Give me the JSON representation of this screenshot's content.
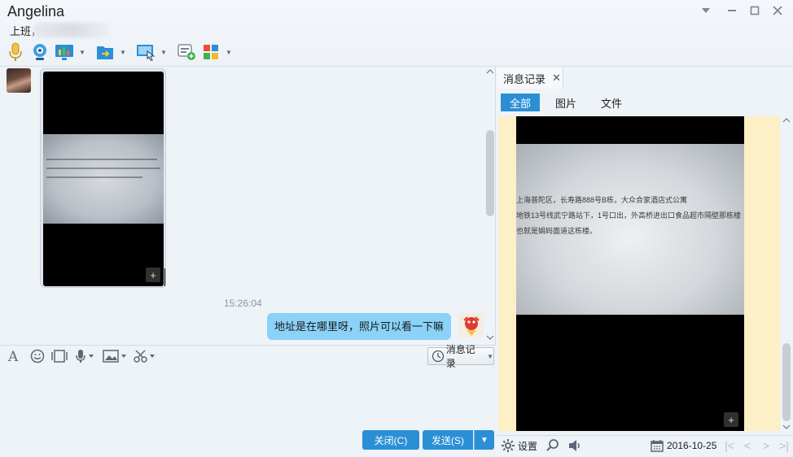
{
  "window": {
    "contact_name": "Angelina",
    "status": "上班，"
  },
  "chat": {
    "timestamp": "15:26:04",
    "outgoing_message": "地址是在哪里呀，照片可以看一下嘛"
  },
  "input": {
    "history_button": "消息记录",
    "close_button": "关闭(C)",
    "send_button": "发送(S)"
  },
  "history_panel": {
    "tab_label": "消息记录",
    "filters": [
      "全部",
      "图片",
      "文件"
    ],
    "active_filter": "全部",
    "photo_text_lines": [
      "上海普陀区，长寿路888号B栋，大众合家酒店式公寓",
      "地铁13号线武宁路站下，1号口出，外高桥进出口食品超市隔壁那栋楼",
      "也就是娟妈面道这栋楼。"
    ],
    "settings_label": "设置",
    "date": "2016-10-25"
  },
  "colors": {
    "accent": "#2b8fd6",
    "bubble": "#8ad2f8",
    "viewer_bg": "#fdefc6"
  }
}
